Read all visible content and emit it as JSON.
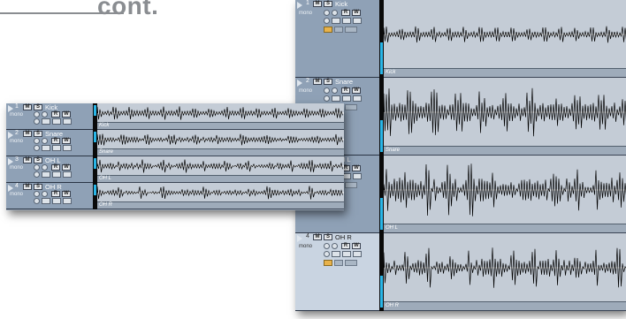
{
  "heading": "cont.",
  "large_window": {
    "tracks": [
      {
        "number": "1",
        "name": "Kick",
        "mode": "mono",
        "mute": "M",
        "solo": "S",
        "read": "R",
        "write": "W",
        "clip": "Kick",
        "selected": false
      },
      {
        "number": "2",
        "name": "Snare",
        "mode": "mono",
        "mute": "M",
        "solo": "S",
        "read": "R",
        "write": "W",
        "clip": "Snare",
        "selected": false
      },
      {
        "number": "3",
        "name": "OH L",
        "mode": "mono",
        "mute": "M",
        "solo": "S",
        "read": "R",
        "write": "W",
        "clip": "OH L",
        "selected": false
      },
      {
        "number": "4",
        "name": "OH R",
        "mode": "mono",
        "mute": "M",
        "solo": "S",
        "read": "R",
        "write": "W",
        "clip": "OH R",
        "selected": true
      }
    ]
  },
  "small_window": {
    "tracks": [
      {
        "number": "1",
        "name": "Kick",
        "mode": "mono",
        "mute": "M",
        "solo": "S",
        "read": "R",
        "write": "W",
        "clip": "Kick"
      },
      {
        "number": "2",
        "name": "Snare",
        "mode": "mono",
        "mute": "M",
        "solo": "S",
        "read": "R",
        "write": "W",
        "clip": "Snare"
      },
      {
        "number": "3",
        "name": "OH L",
        "mode": "mono",
        "mute": "M",
        "solo": "S",
        "read": "R",
        "write": "W",
        "clip": "OH L"
      },
      {
        "number": "4",
        "name": "OH R",
        "mode": "mono",
        "mute": "M",
        "solo": "S",
        "read": "R",
        "write": "W",
        "clip": "OH R"
      }
    ]
  },
  "colors": {
    "meter": "#29b6e8",
    "waveform": "#000000",
    "lane": "#c4ccd6"
  },
  "icons": [
    "expand-triangle-icon",
    "mute-icon",
    "solo-icon",
    "monitor-icon",
    "speaker-icon",
    "read-icon",
    "write-icon",
    "edit-icon",
    "instrument-icon",
    "folder-icon",
    "lane-icon"
  ]
}
